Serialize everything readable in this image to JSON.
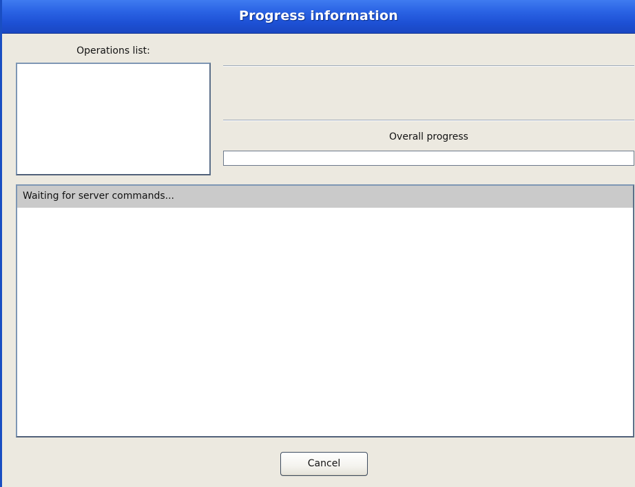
{
  "window": {
    "title": "Progress information"
  },
  "operations": {
    "label": "Operations list:",
    "items": []
  },
  "current_operation": {
    "text": ""
  },
  "overall": {
    "label": "Overall progress",
    "progress_percent": 0
  },
  "log": {
    "rows": [
      "Waiting for server commands..."
    ]
  },
  "buttons": {
    "cancel_label": "Cancel"
  },
  "colors": {
    "titlebar": "#2a63e4",
    "window_bg": "#ece9e0",
    "selected_row": "#cacaca"
  }
}
